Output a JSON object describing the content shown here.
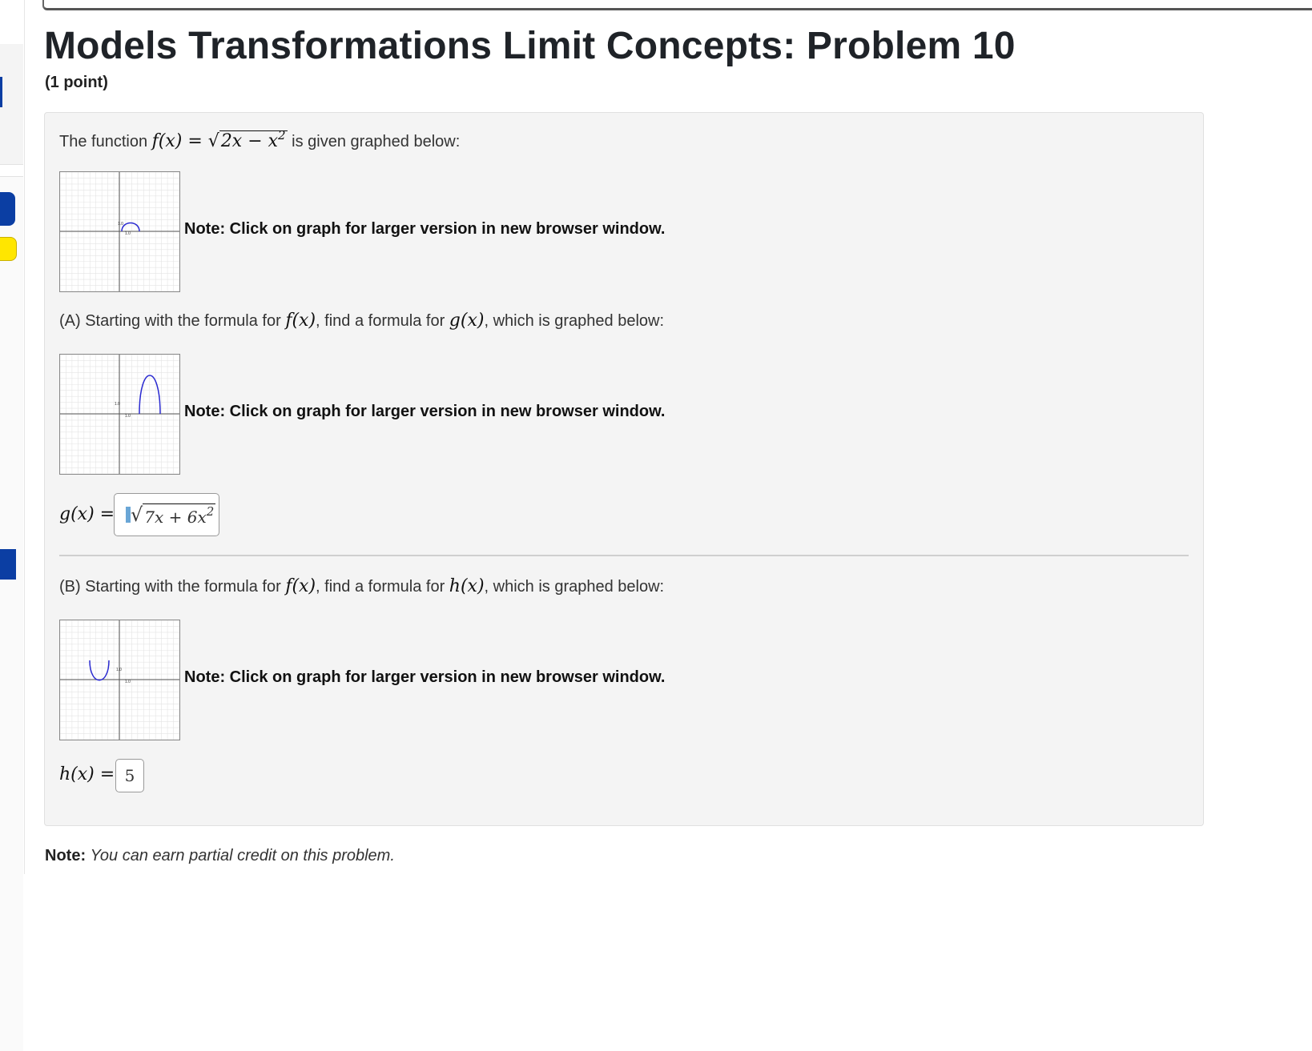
{
  "page": {
    "title": "Models Transformations Limit Concepts: Problem 10",
    "points": "(1 point)"
  },
  "intro": {
    "prefix": "The function ",
    "func_lhs": "f(x) =",
    "func_radicand": "2x − x",
    "func_exp": "2",
    "suffix": " is given graphed below:"
  },
  "graph_note": "Note: Click on graph for larger version in new browser window.",
  "part_a": {
    "prefix": "(A) Starting with the formula for ",
    "f": "f(x)",
    "middle": ", find a formula for ",
    "g": "g(x)",
    "suffix": ", which is graphed below:",
    "answer_label": "g(x) =",
    "answer_radicand": "7x + 6x",
    "answer_exp": "2"
  },
  "part_b": {
    "prefix": "(B) Starting with the formula for ",
    "f": "f(x)",
    "middle": ", find a formula for ",
    "h": "h(x)",
    "suffix": ", which is graphed below:",
    "answer_label": "h(x) =",
    "answer_value": "5"
  },
  "footer": {
    "bold": "Note:",
    "text": "You can earn partial credit on this problem."
  },
  "graphs": {
    "tick_label": "1.0"
  },
  "colors": {
    "curve": "#2a2ad0",
    "accent_blue": "#0b3ea3",
    "accent_yellow": "#ffe600"
  }
}
